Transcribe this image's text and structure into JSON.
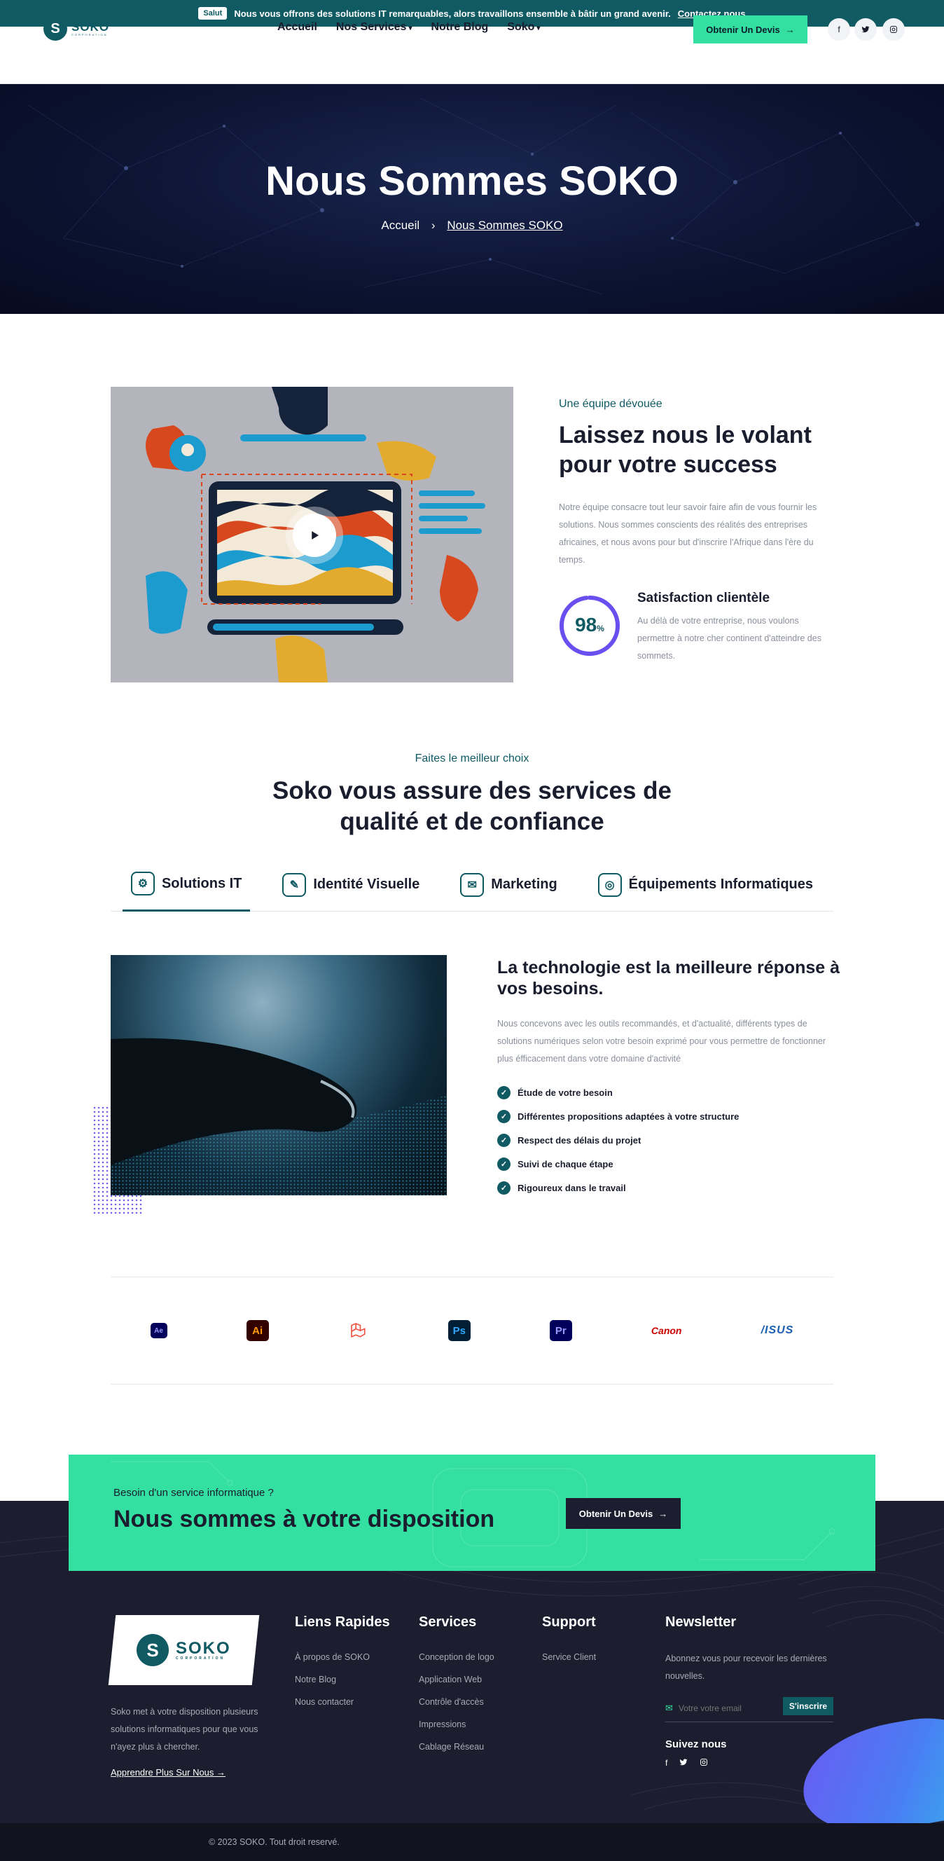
{
  "topbar": {
    "badge": "Salut",
    "message": "Nous vous offrons des solutions IT remarquables, alors travaillons ensemble à bâtir un grand avenir.",
    "link": "Contactez nous"
  },
  "header": {
    "logo_text": "SOKO",
    "logo_sub": "CORPORATION",
    "nav": [
      {
        "label": "Accueil"
      },
      {
        "label": "Nos Services"
      },
      {
        "label": "Notre Blog"
      },
      {
        "label": "Soko"
      }
    ],
    "cta_label": "Obtenir Un Devis"
  },
  "hero": {
    "title": "Nous Sommes SOKO",
    "crumb_home": "Accueil",
    "crumb_current": "Nous Sommes SOKO"
  },
  "about": {
    "eyebrow": "Une équipe dévouée",
    "title": "Laissez nous le volant pour votre success",
    "text": "Notre équipe consacre tout leur savoir faire afin de vous fournir les solutions. Nous sommes conscients des réalités des entreprises africaines, et nous avons pour but d'inscrire l'Afrique dans l'ère du temps.",
    "satisfaction_value": "98",
    "satisfaction_unit": "%",
    "satisfaction_fraction": 0.98,
    "satisfaction_title": "Satisfaction clientèle",
    "satisfaction_text": "Au délà de votre entreprise, nous voulons permettre à notre cher continent d'atteindre des sommets."
  },
  "services": {
    "eyebrow": "Faites le meilleur choix",
    "title": "Soko vous assure des services de qualité et de confiance",
    "tabs": [
      {
        "label": "Solutions IT"
      },
      {
        "label": "Identité Visuelle"
      },
      {
        "label": "Marketing"
      },
      {
        "label": "Équipements Informatiques"
      }
    ],
    "heading": "La technologie est la meilleure réponse à vos besoins.",
    "text": "Nous concevons avec les outils recommandés, et d'actualité, différents types de solutions numériques selon votre besoin exprimé pour vous permettre de fonctionner plus éfficacement dans votre domaine d'activité",
    "checks": [
      "Étude de votre besoin",
      "Différentes propositions adaptées à votre structure",
      "Respect des délais du projet",
      "Suivi de chaque étape",
      "Rigoureux dans le travail"
    ]
  },
  "brands": {
    "ae": "Ae",
    "ai": "Ai",
    "ps": "Ps",
    "pr": "Pr",
    "canon": "Canon",
    "asus": "/ISUS"
  },
  "cta": {
    "eyebrow": "Besoin d'un service informatique ?",
    "title": "Nous sommes à votre disposition",
    "button": "Obtenir Un Devis"
  },
  "footer": {
    "logo_text": "SOKO",
    "logo_sub": "CORPORATION",
    "about": "Soko met à votre disposition plusieurs solutions informatiques pour que vous n'ayez plus à chercher.",
    "more": "Apprendre Plus Sur Nous",
    "col1": {
      "title": "Liens Rapides",
      "items": [
        "À propos de SOKO",
        "Notre Blog",
        "Nous contacter"
      ]
    },
    "col2": {
      "title": "Services",
      "items": [
        "Conception de logo",
        "Application Web",
        "Contrôle d'accès",
        "Impressions",
        "Cablage Réseau"
      ]
    },
    "col3": {
      "title": "Support",
      "items": [
        "Service Client"
      ]
    },
    "newsletter": {
      "title": "Newsletter",
      "text": "Abonnez vous pour recevoir les dernières nouvelles.",
      "placeholder": "Votre votre email",
      "button": "S'inscrire",
      "follow": "Suivez nous"
    },
    "copyright": "© 2023 SOKO. Tout droit reservé."
  }
}
